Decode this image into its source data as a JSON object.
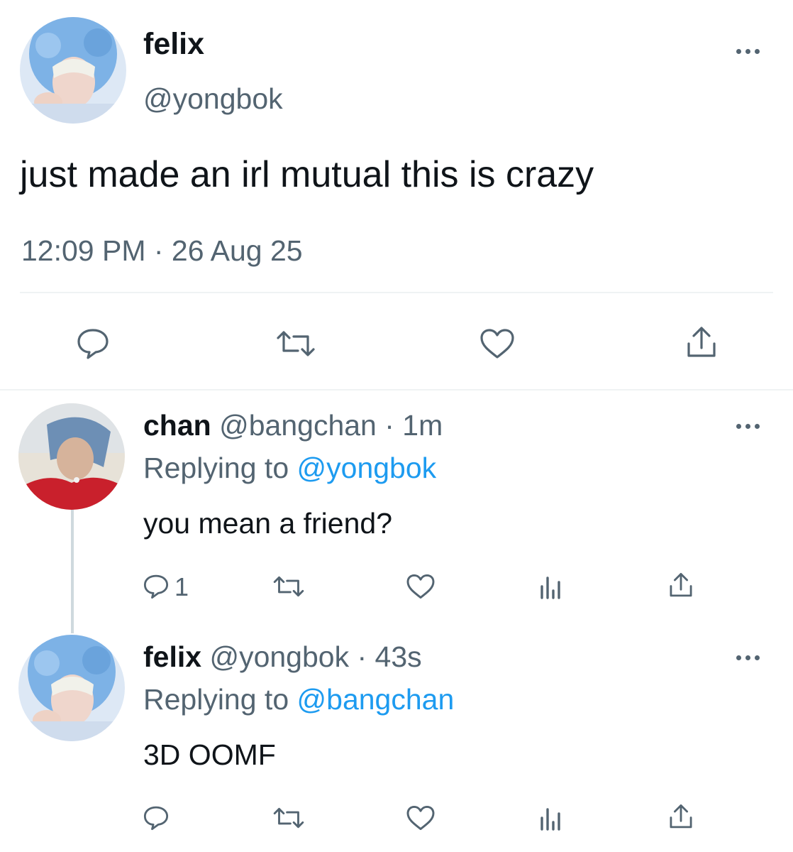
{
  "main_tweet": {
    "display_name": "felix",
    "handle": "@yongbok",
    "text": "just made an irl mutual this is crazy",
    "timestamp": "12:09 PM · 26 Aug 25",
    "actions": [
      "reply-icon",
      "retweet-icon",
      "like-icon",
      "share-icon"
    ]
  },
  "replies": [
    {
      "display_name": "chan",
      "handle": "@bangchan",
      "time": "· 1m",
      "replying_label": "Replying to",
      "replying_to": "@yongbok",
      "text": "you mean a friend?",
      "reply_count": "1"
    },
    {
      "display_name": "felix",
      "handle": "@yongbok",
      "time": "· 43s",
      "replying_label": "Replying to",
      "replying_to": "@bangchan",
      "text": "3D OOMF"
    }
  ],
  "colors": {
    "text": "#0f1419",
    "muted": "#536471",
    "link": "#1d9bf0",
    "divider": "#eff3f4"
  }
}
